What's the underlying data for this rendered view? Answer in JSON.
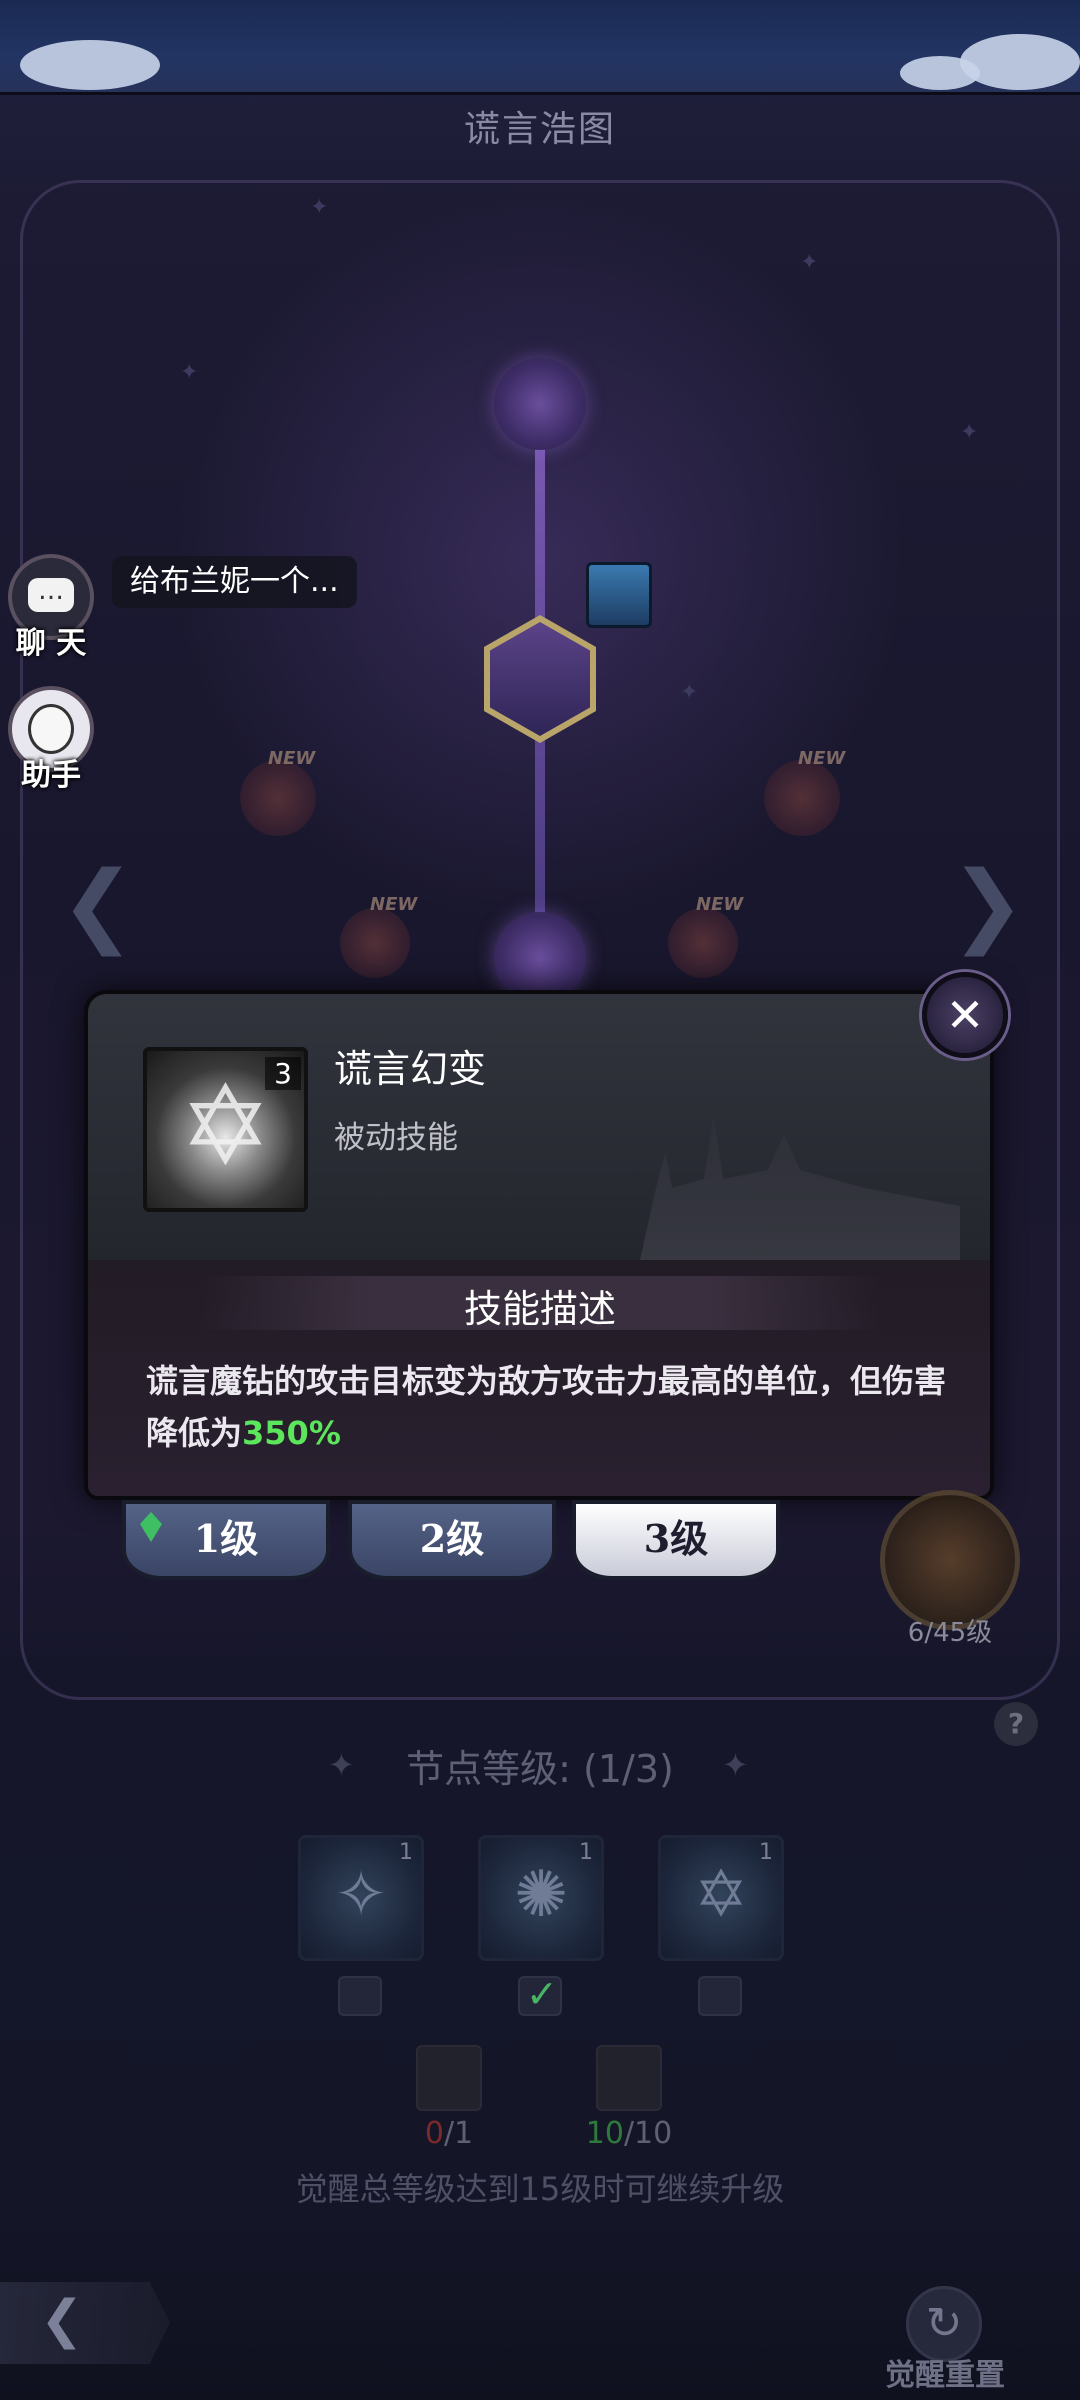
{
  "header": {
    "title": "谎言浩图"
  },
  "side": {
    "chat_label": "聊 天",
    "assistant_label": "助手",
    "chat_preview": "给布兰妮一个..."
  },
  "tree": {
    "new_tag": "NEW"
  },
  "popup": {
    "skill_name": "谎言幻变",
    "skill_type": "被动技能",
    "skill_level": "3",
    "desc_header": "技能描述",
    "desc_text": "谎言魔钻的攻击目标变为敌方攻击力最高的单位，但伤害降低为",
    "desc_highlight": "350%",
    "close_icon": "close-x-icon"
  },
  "level_tabs": [
    "1级",
    "2级",
    "3级"
  ],
  "level_tabs_active": 2,
  "awaken": {
    "level_text": "6/45级"
  },
  "node_section": {
    "title": "节点等级: (1/3)",
    "cards": [
      {
        "level": "1",
        "checked": false
      },
      {
        "level": "1",
        "checked": true
      },
      {
        "level": "1",
        "checked": false
      }
    ]
  },
  "materials": [
    {
      "have": "0",
      "need": "/1",
      "have_color": "#7a2a2a"
    },
    {
      "have": "10",
      "need": "/10",
      "have_color": "#2e7a3d"
    }
  ],
  "awaken_hint": "觉醒总等级达到15级时可继续升级",
  "footer": {
    "reset_label": "觉醒重置"
  },
  "colors": {
    "highlight_green": "#5ce65c",
    "accent_purple": "#6a4e9c"
  }
}
